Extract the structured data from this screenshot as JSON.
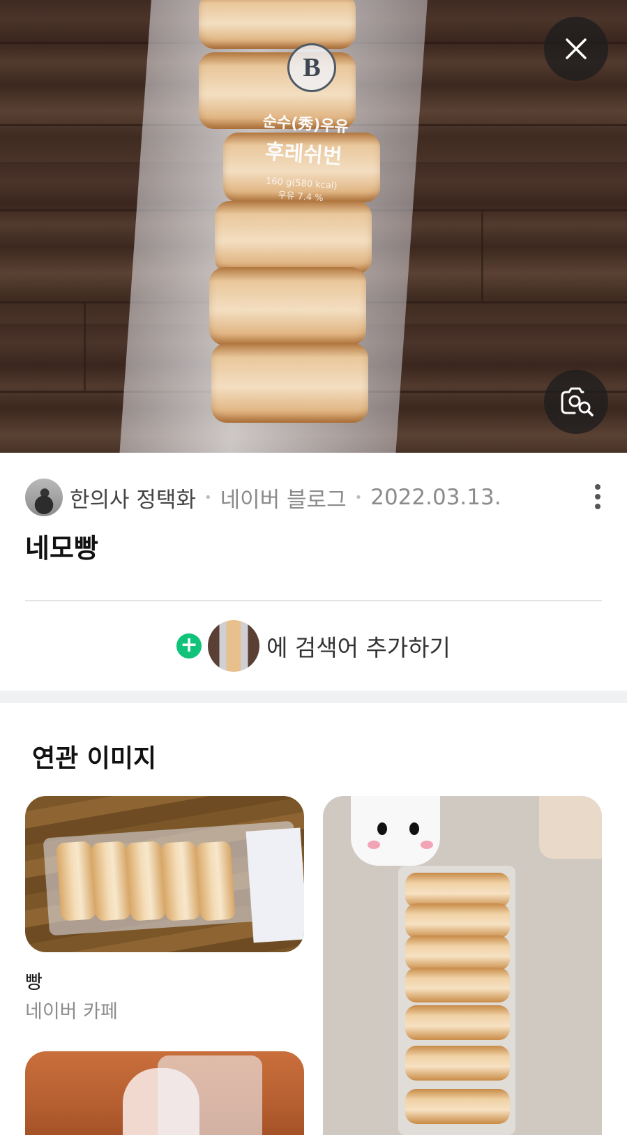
{
  "hero": {
    "image_name": "product-photo",
    "bag_print": {
      "logo": "B",
      "line1": "순수(秀)우유",
      "line2": "후레쉬번",
      "line3": "160 g(580 kcal)",
      "line4": "우유 7.4 %"
    }
  },
  "actions": {
    "close_icon": "close-icon",
    "lens_icon": "image-search-icon"
  },
  "meta": {
    "author": "한의사 정택화",
    "source": "네이버 블로그",
    "date": "2022.03.13.",
    "separator": "•"
  },
  "title": "네모빵",
  "add_search": {
    "plus": "+",
    "label": "에 검색어 추가하기"
  },
  "related": {
    "heading": "연관 이미지",
    "items": [
      {
        "title": "빵",
        "source": "네이버 카페"
      }
    ]
  },
  "colors": {
    "accent_green": "#10c37a",
    "text_primary": "#111111",
    "text_secondary": "#8b8b8b",
    "divider": "#e4e4e4"
  }
}
